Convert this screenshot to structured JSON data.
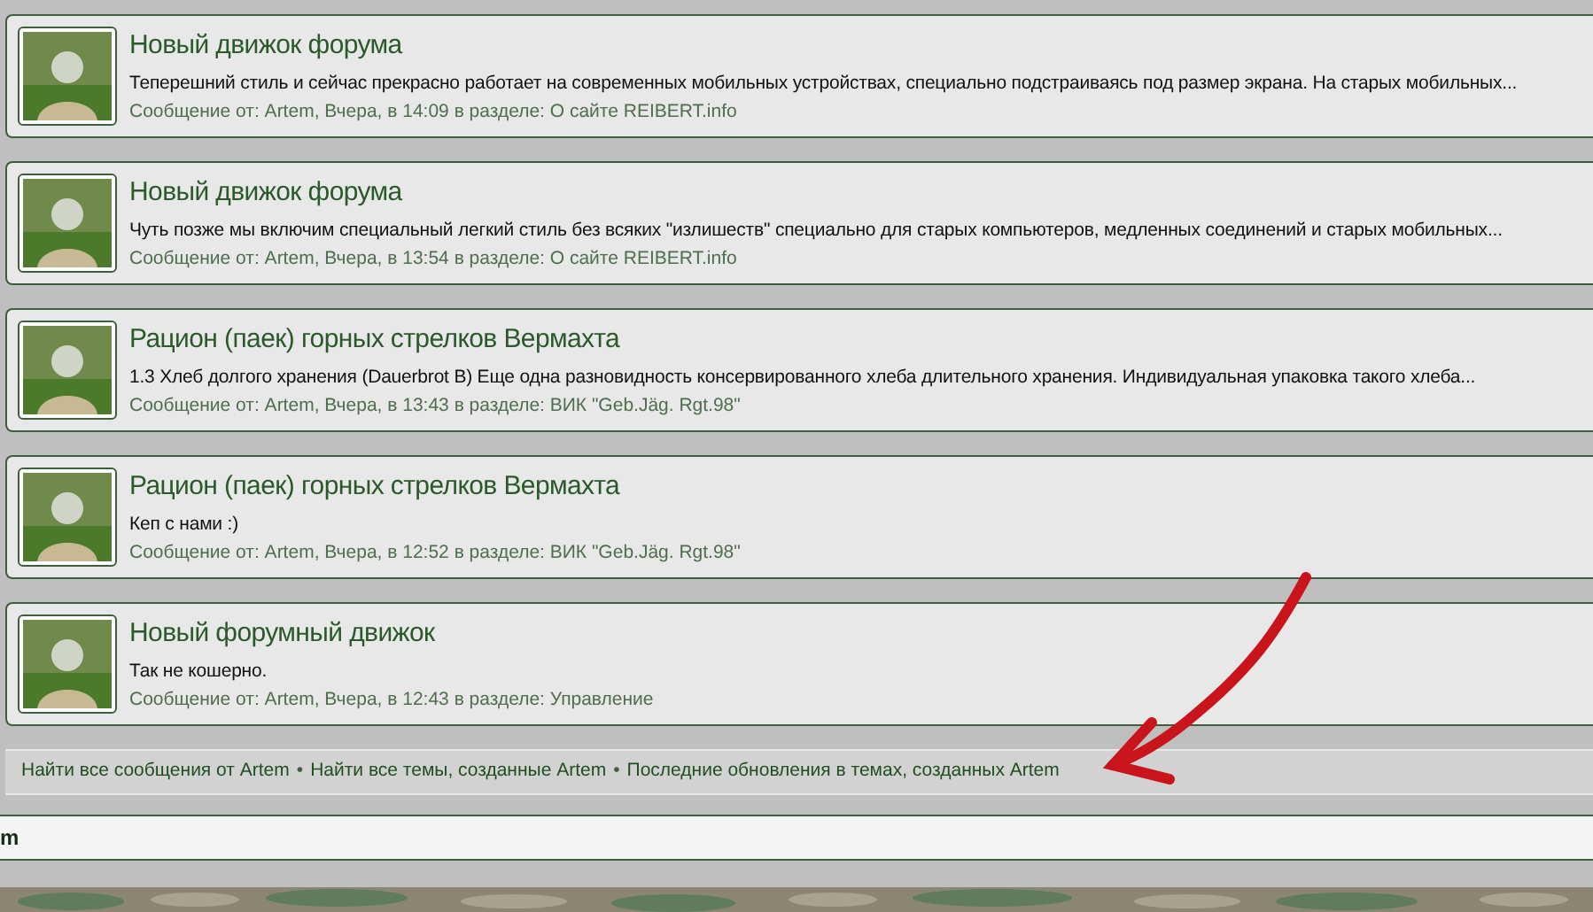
{
  "results": [
    {
      "title": "Новый движок форума",
      "excerpt": "Теперешний стиль и сейчас прекрасно работает на современных мобильных устройствах, специально подстраиваясь под размер экрана. На старых мобильных...",
      "meta": "Сообщение от: Artem, Вчера, в 14:09 в разделе: О сайте REIBERT.info"
    },
    {
      "title": "Новый движок форума",
      "excerpt": "Чуть позже мы включим специальный легкий стиль без всяких \"излишеств\" специально для старых компьютеров, медленных соединений и старых мобильных...",
      "meta": "Сообщение от: Artem, Вчера, в 13:54 в разделе: О сайте REIBERT.info"
    },
    {
      "title": "Рацион (паек) горных стрелков Вермахта",
      "excerpt": "1.3 Хлеб долгого хранения (Dauerbrot B) Еще одна разновидность консервированного хлеба длительного хранения. Индивидуальная упаковка такого хлеба...",
      "meta": "Сообщение от: Artem, Вчера, в 13:43 в разделе: ВИК \"Geb.Jäg. Rgt.98\""
    },
    {
      "title": "Рацион (паек) горных стрелков Вермахта",
      "excerpt": "Кеп с нами :)",
      "meta": "Сообщение от: Artem, Вчера, в 12:52 в разделе: ВИК \"Geb.Jäg. Rgt.98\""
    },
    {
      "title": "Новый форумный движок",
      "excerpt": "Так не кошерно.",
      "meta": "Сообщение от: Artem, Вчера, в 12:43 в разделе: Управление"
    }
  ],
  "footer_links": [
    {
      "kind": "link",
      "text": "Найти все сообщения от Artem"
    },
    {
      "kind": "separator",
      "text": "•"
    },
    {
      "kind": "link",
      "text": "Найти все темы, созданные Artem"
    },
    {
      "kind": "separator",
      "text": "•"
    },
    {
      "kind": "link",
      "text": "Последние обновления в темах, созданных Artem"
    }
  ],
  "bottom_bar": {
    "text": "m"
  }
}
